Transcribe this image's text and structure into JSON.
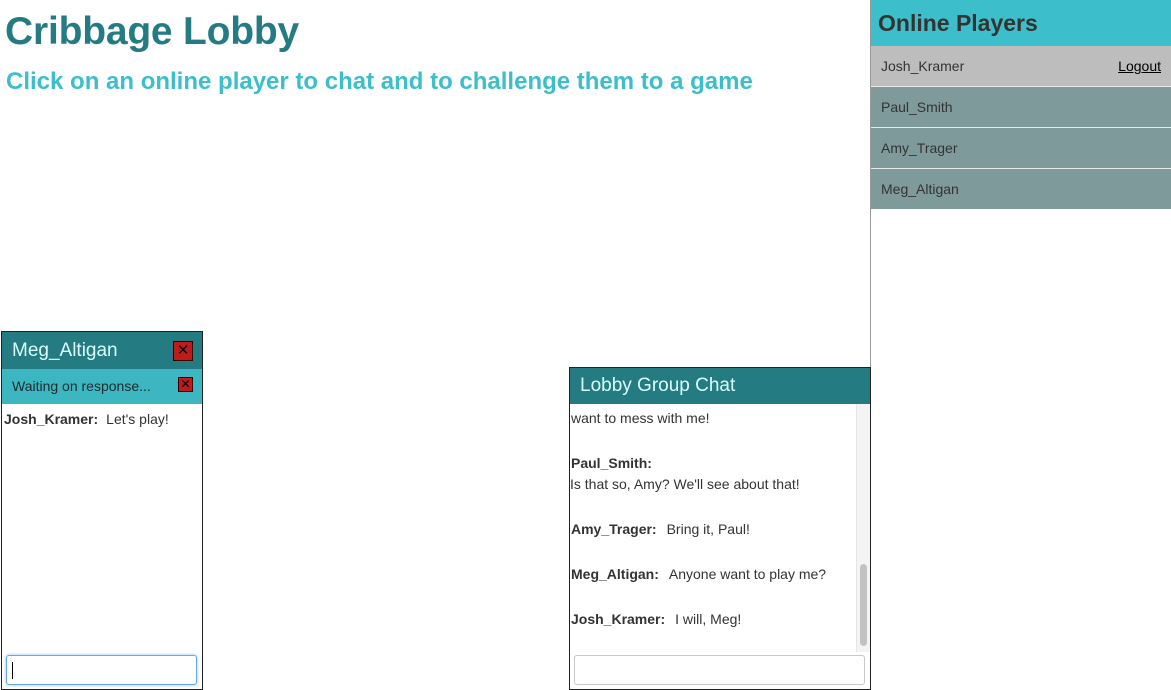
{
  "header": {
    "title": "Cribbage Lobby",
    "subtitle": "Click on an online player to chat and to challenge them to a game"
  },
  "players_panel": {
    "title": "Online Players",
    "self": {
      "name": "Josh_Kramer",
      "logout_label": "Logout"
    },
    "players": [
      "Paul_Smith",
      "Amy_Trager",
      "Meg_Altigan"
    ]
  },
  "private_chat": {
    "title": "Meg_Altigan",
    "status": "Waiting on response...",
    "close_symbol": "✕",
    "messages": [
      {
        "from": "Josh_Kramer:",
        "text": "Let's play!"
      }
    ],
    "input_value": ""
  },
  "group_chat": {
    "title": "Lobby Group Chat",
    "cut_line": "want to mess with me!",
    "messages": [
      {
        "from": "Paul_Smith:",
        "text": "Is that so, Amy? We'll see about that!"
      },
      {
        "from": "Amy_Trager:",
        "text": "Bring it, Paul!"
      },
      {
        "from": "Meg_Altigan:",
        "text": "Anyone want to play me?"
      },
      {
        "from": "Josh_Kramer:",
        "text": "I will, Meg!"
      }
    ],
    "input_value": ""
  },
  "colors": {
    "title": "#257b82",
    "subtitle": "#3cbfcb",
    "panel_header": "#3cbfcb",
    "player_row": "#7f9a9b",
    "self_row": "#bdbdbd",
    "close_button": "#c01a1a"
  },
  "icons": {
    "close": "close-icon",
    "dismiss_status": "close-icon"
  }
}
